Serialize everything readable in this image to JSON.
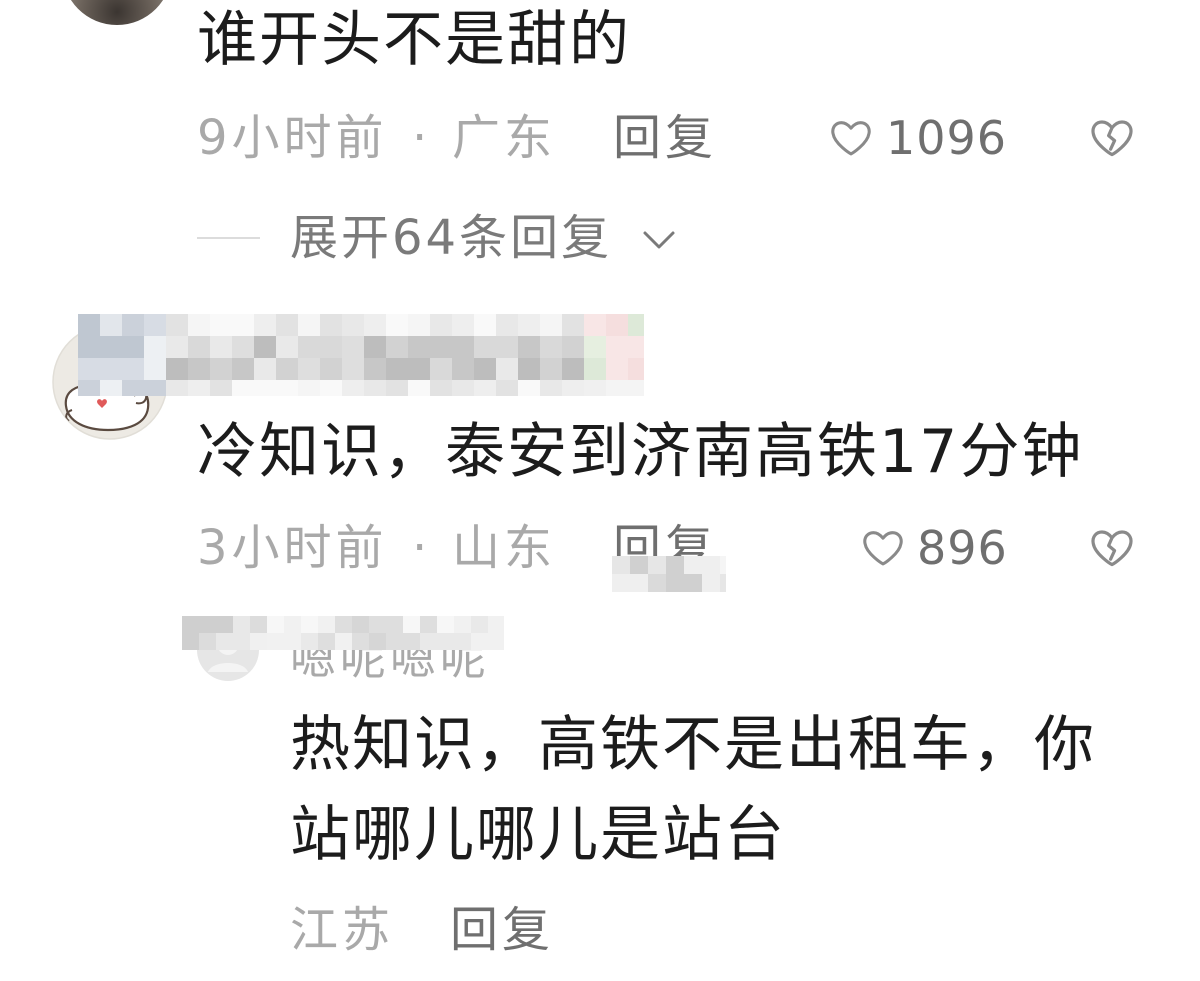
{
  "colors": {
    "background": "#ffffff",
    "primary_text": "#1c1c1c",
    "meta_text": "#a9a9a9",
    "action_text": "#6f6f6f",
    "expand_text": "#7a7a7a",
    "icon_stroke": "#8a8a8a",
    "divider": "#dcdcdc"
  },
  "icons": {
    "like": "heart-outline-icon",
    "dislike": "broken-heart-icon",
    "expand": "chevron-down-icon"
  },
  "separator": "·",
  "comments": [
    {
      "text": "谁开头不是甜的",
      "time": "9小时前",
      "location": "广东",
      "reply_label": "回复",
      "likes": "1096",
      "expand_label": "展开64条回复"
    },
    {
      "text": "冷知识，泰安到济南高铁17分钟",
      "time": "3小时前",
      "location": "山东",
      "reply_label": "回复",
      "likes": "896",
      "replies": [
        {
          "username": "嗯呢嗯呢",
          "text_lines": [
            "热知识，高铁不是出租车，你",
            "站哪儿哪儿是站台"
          ],
          "location": "江苏",
          "reply_label": "回复"
        }
      ]
    }
  ]
}
